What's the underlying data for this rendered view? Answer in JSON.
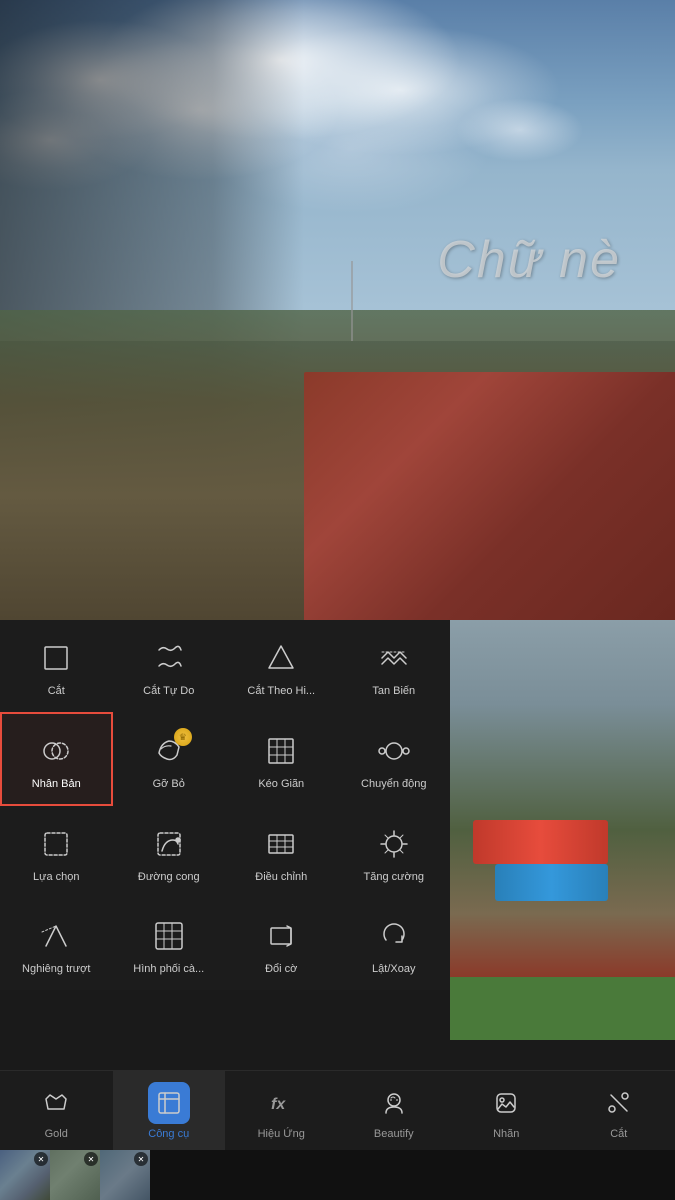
{
  "photo": {
    "text_overlay": "Chữ nè"
  },
  "tools": {
    "row1": [
      {
        "id": "cat",
        "label": "Cắt",
        "icon": "crop"
      },
      {
        "id": "cat-tu-do",
        "label": "Cắt Tự Do",
        "icon": "free-crop"
      },
      {
        "id": "cat-theo-hinh",
        "label": "Cắt Theo Hi...",
        "icon": "shape-crop"
      },
      {
        "id": "tan-bien",
        "label": "Tan Biến",
        "icon": "dissolve"
      }
    ],
    "row2": [
      {
        "id": "nhan-ban",
        "label": "Nhân Bản",
        "icon": "duplicate",
        "active": true
      },
      {
        "id": "go-bo",
        "label": "Gỡ Bỏ",
        "icon": "remove",
        "premium": true
      },
      {
        "id": "keo-gian",
        "label": "Kéo Giãn",
        "icon": "stretch"
      },
      {
        "id": "chuyen-dong",
        "label": "Chuyển động",
        "icon": "motion"
      }
    ],
    "row3": [
      {
        "id": "lua-chon",
        "label": "Lựa chọn",
        "icon": "select"
      },
      {
        "id": "duong-cong",
        "label": "Đường cong",
        "icon": "curve"
      },
      {
        "id": "dieu-chinh",
        "label": "Điều chỉnh",
        "icon": "adjust"
      },
      {
        "id": "tang-cuong",
        "label": "Tăng cường",
        "icon": "enhance"
      }
    ],
    "row4": [
      {
        "id": "nghieng-truot",
        "label": "Nghiêng trượt",
        "icon": "tilt"
      },
      {
        "id": "hinh-phoi-ca",
        "label": "Hình phối cà...",
        "icon": "blend"
      },
      {
        "id": "doi-co",
        "label": "Đổi cờ",
        "icon": "resize"
      },
      {
        "id": "lat-xoay",
        "label": "Lật/Xoay",
        "icon": "flip-rotate"
      }
    ]
  },
  "bottom_nav": [
    {
      "id": "gold",
      "label": "Gold",
      "icon": "crown"
    },
    {
      "id": "cong-cu",
      "label": "Công cụ",
      "icon": "crop-tool",
      "active": true
    },
    {
      "id": "hieu-ung",
      "label": "Hiệu Ứng",
      "icon": "fx"
    },
    {
      "id": "beautify",
      "label": "Beautify",
      "icon": "face"
    },
    {
      "id": "nhan",
      "label": "Nhãn",
      "icon": "sticker"
    },
    {
      "id": "cat-nav",
      "label": "Cắt",
      "icon": "scissors"
    }
  ]
}
